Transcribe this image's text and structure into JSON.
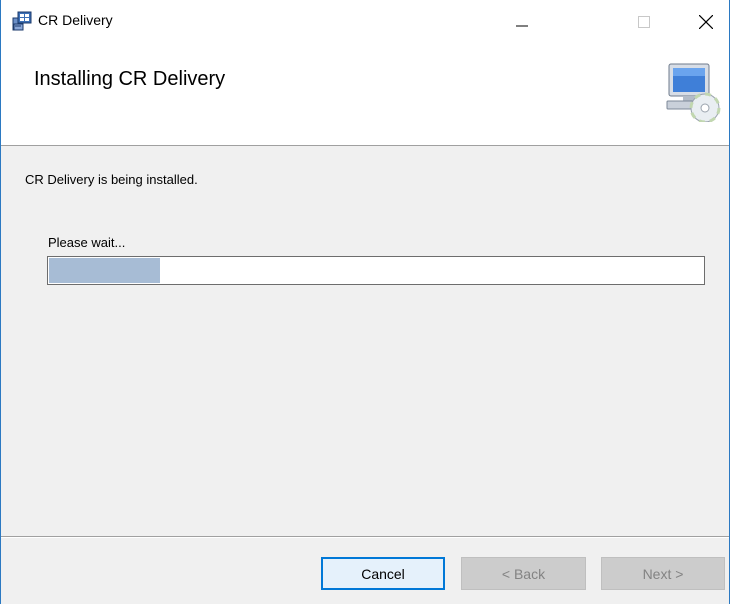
{
  "window": {
    "title": "CR Delivery",
    "controls": {
      "minimize": "minimize",
      "maximize": "maximize",
      "close": "close"
    }
  },
  "header": {
    "title": "Installing CR Delivery",
    "icon": "computer-cd-setup-icon"
  },
  "body": {
    "status": "CR Delivery is being installed.",
    "wait_label": "Please wait...",
    "progress_fraction": 0.17
  },
  "footer": {
    "cancel_label": "Cancel",
    "back_label": "< Back",
    "next_label": "Next >"
  },
  "colors": {
    "accent": "#0078d7",
    "progress_fill": "#a7bcd5",
    "window_border": "#2b79c2"
  }
}
